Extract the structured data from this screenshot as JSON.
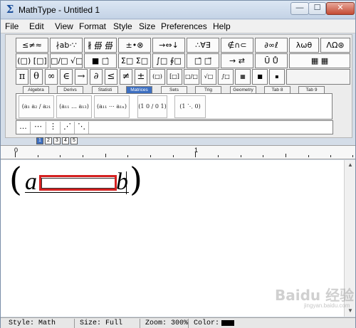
{
  "window": {
    "title": "MathType - Untitled 1",
    "app_icon": "Σ",
    "min_glyph": "—",
    "max_glyph": "☐",
    "close_glyph": "✕"
  },
  "menu": [
    "File",
    "Edit",
    "View",
    "Format",
    "Style",
    "Size",
    "Preferences",
    "Help"
  ],
  "palette_row1": [
    "≤≠≈",
    "∤ab·∵",
    "∦ ∰ ∰",
    "±•⊗",
    "→⇔↓",
    "∴∀∃",
    "∉∩⊂",
    "∂∞ℓ",
    "λωθ",
    "ΛΩ⊛"
  ],
  "palette_row2": [
    "(□) [□]",
    "□/□ √□",
    "■ □̇",
    "Σ□ Σ□",
    "∫□ ∮□",
    "□̄ □⃗",
    "→ ⇄",
    "Ū Ů",
    "▦ ▦"
  ],
  "symbol_row": [
    "π",
    "θ",
    "∞",
    "∈",
    "→",
    "∂",
    "≤",
    "≠",
    "±",
    "(□)",
    "[□]",
    "□/□",
    "√□",
    "∫□",
    "▦",
    "■",
    "▪"
  ],
  "tabs": [
    "Algebra",
    "Derivs",
    "Statisti",
    "Matrices",
    "Sets",
    "Trig",
    "Geometry",
    "Tab 8",
    "Tab 9"
  ],
  "active_tab": "Matrices",
  "templates": [
    "(a₁ a₂ / a₂₁ a₂₂)",
    "(a₁₁ … a₁₃)",
    "(a₁₁ ⋯ a₁ₙ)",
    "(1 0 / 0 1)",
    "(1 ⋱ 0)"
  ],
  "dots": [
    "…",
    "⋯",
    "⋮",
    "⋰",
    "⋱"
  ],
  "minitabs": [
    "1",
    "2",
    "3",
    "4",
    "5"
  ],
  "ruler": {
    "marks": [
      "0",
      "1"
    ]
  },
  "equation": {
    "left_paren": "(",
    "var_a": "a",
    "var_b": "b",
    "right_paren": ")"
  },
  "watermark": {
    "text": "Baidu 经验",
    "sub": "jingyan.baidu.com"
  },
  "status": {
    "style": "Style: Math",
    "size": "Size: Full",
    "zoom": "Zoom: 300%",
    "color_label": "Color:",
    "color": "#000000"
  }
}
